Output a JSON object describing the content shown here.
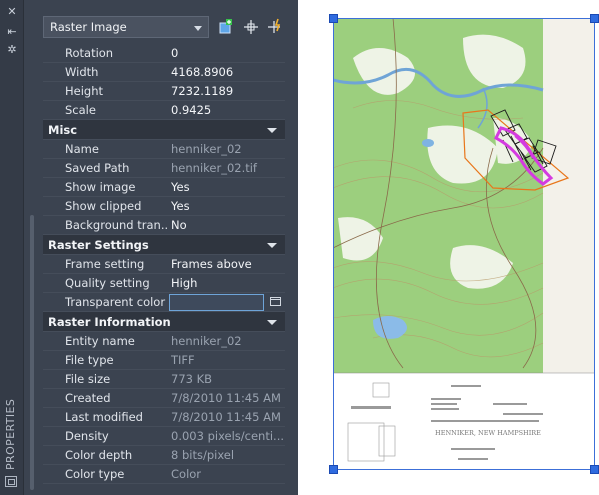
{
  "palette": {
    "title": "PROPERTIES",
    "object_type": "Raster Image",
    "rows_top": [
      {
        "label": "Rotation",
        "value": "0"
      },
      {
        "label": "Width",
        "value": "4168.8906"
      },
      {
        "label": "Height",
        "value": "7232.1189"
      },
      {
        "label": "Scale",
        "value": "0.9425"
      }
    ],
    "misc": {
      "title": "Misc",
      "rows": [
        {
          "label": "Name",
          "value": "henniker_02"
        },
        {
          "label": "Saved Path",
          "value": "henniker_02.tif"
        },
        {
          "label": "Show image",
          "value": "Yes"
        },
        {
          "label": "Show clipped",
          "value": "Yes"
        },
        {
          "label": "Background tran...",
          "value": "No"
        }
      ]
    },
    "raster_settings": {
      "title": "Raster Settings",
      "rows": [
        {
          "label": "Frame setting",
          "value": "Frames above"
        },
        {
          "label": "Quality setting",
          "value": "High"
        },
        {
          "label": "Transparent color",
          "value": ""
        }
      ]
    },
    "raster_info": {
      "title": "Raster Information",
      "rows": [
        {
          "label": "Entity name",
          "value": "henniker_02"
        },
        {
          "label": "File type",
          "value": "TIFF"
        },
        {
          "label": "File size",
          "value": "773 KB"
        },
        {
          "label": "Created",
          "value": "7/8/2010 11:45 AM"
        },
        {
          "label": "Last modified",
          "value": "7/8/2010 11:45 AM"
        },
        {
          "label": "Density",
          "value": "0.003 pixels/centi..."
        },
        {
          "label": "Color depth",
          "value": "8 bits/pixel"
        },
        {
          "label": "Color type",
          "value": "Color"
        }
      ]
    }
  },
  "map": {
    "footer_title": "HENNIKER, NEW HAMPSHIRE"
  },
  "colors": {
    "palette_bg": "#3b4350",
    "section_bg": "#2f353f",
    "grip": "#2f6bdf",
    "map_green": "#9ccf7e",
    "boundary_orange": "#e8761b",
    "highlight_magenta": "#d43be0"
  }
}
